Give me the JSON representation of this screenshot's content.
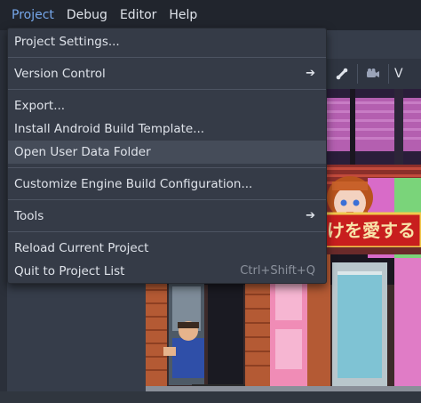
{
  "menubar": {
    "items": [
      "Project",
      "Debug",
      "Editor",
      "Help"
    ]
  },
  "toolbar": {
    "view_label": "V"
  },
  "dropdown": {
    "project_settings": "Project Settings...",
    "version_control": "Version Control",
    "export": "Export...",
    "install_android": "Install Android Build Template...",
    "open_user_data": "Open User Data Folder",
    "customize_engine": "Customize Engine Build Configuration...",
    "tools": "Tools",
    "reload_project": "Reload Current Project",
    "quit_to_list": "Quit to Project List",
    "quit_shortcut": "Ctrl+Shift+Q"
  },
  "scene": {
    "sign_text": "けを愛する"
  },
  "colors": {
    "menu_active": "#76a7ea",
    "menu_bg": "#353b47",
    "hover_bg": "#454c59"
  }
}
